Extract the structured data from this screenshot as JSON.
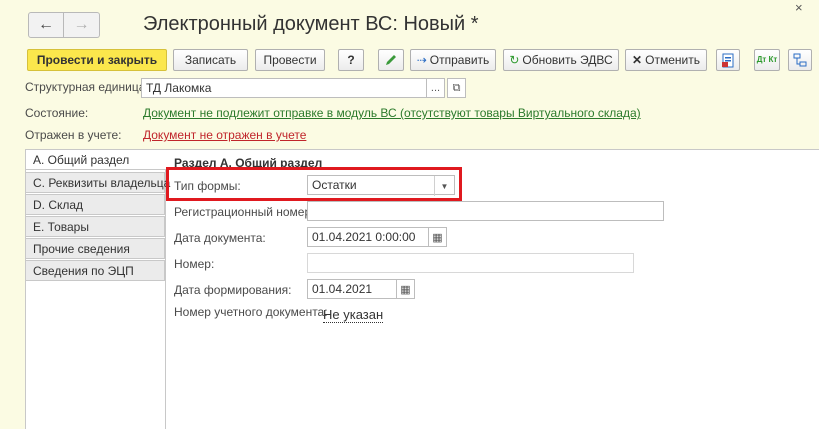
{
  "window": {
    "title": "Электронный документ ВС: Новый *",
    "close": "×"
  },
  "nav": {
    "back": "←",
    "forward": "→"
  },
  "toolbar": {
    "post_close": "Провести и закрыть",
    "write": "Записать",
    "post": "Провести",
    "help": "?",
    "send": "Отправить",
    "refresh_edvs": "Обновить ЭДВС",
    "cancel": "Отменить",
    "dtkt": "Дт Кт"
  },
  "header": {
    "unit_label": "Структурная единица:",
    "unit_value": "ТД Лакомка",
    "state_label": "Состояние:",
    "state_value": "Документ не подлежит отправке в модуль ВС (отсутствуют товары Виртуального склада)",
    "accounting_label": "Отражен в учете:",
    "accounting_value": "Документ не отражен в учете"
  },
  "tabs": [
    {
      "label": "А. Общий раздел"
    },
    {
      "label": "С. Реквизиты владельца"
    },
    {
      "label": "D. Склад"
    },
    {
      "label": "Е. Товары"
    },
    {
      "label": "Прочие сведения"
    },
    {
      "label": "Сведения по ЭЦП"
    }
  ],
  "section_a": {
    "title": "Раздел А. Общий раздел",
    "form_type_label": "Тип формы:",
    "form_type_value": "Остатки",
    "reg_number_label": "Регистрационный номер:",
    "reg_number_value": "",
    "doc_date_label": "Дата документа:",
    "doc_date_value": "01.04.2021  0:00:00",
    "number_label": "Номер:",
    "number_value": "",
    "gen_date_label": "Дата формирования:",
    "gen_date_value": "01.04.2021",
    "acc_doc_number_label": "Номер учетного документа:",
    "acc_doc_number_value": "Не указан"
  },
  "colors": {
    "primary_button": "#fbe74c",
    "highlight": "#e0191f",
    "background": "#fbfbe3"
  }
}
